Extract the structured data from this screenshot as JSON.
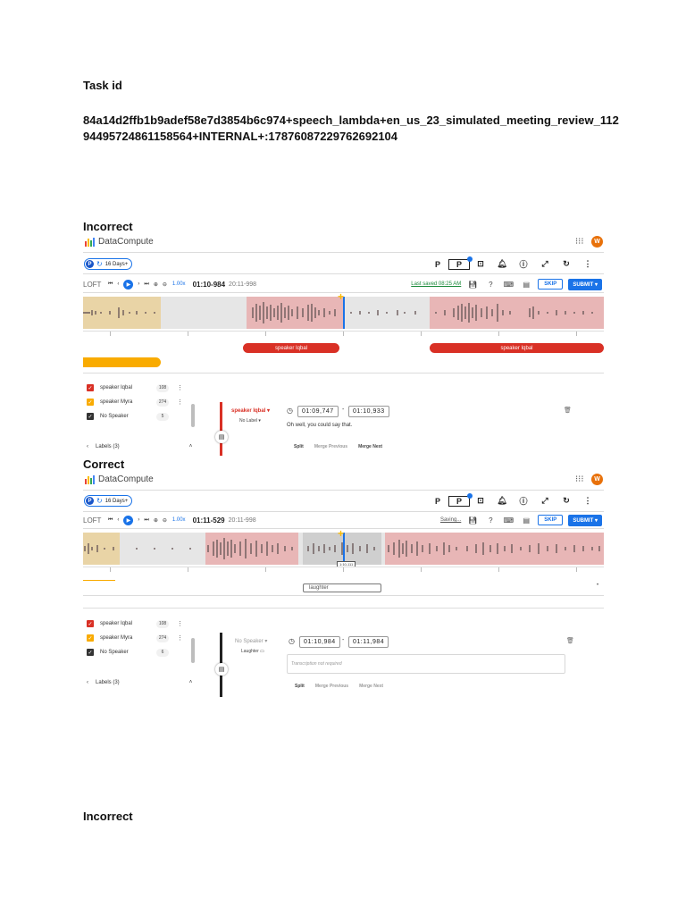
{
  "document": {
    "task_heading": "Task id",
    "task_id": "84a14d2ffb1b9adef58e7d3854b6c974+speech_lambda+en_us_23_simulated_meeting_review_11294495724861158564+INTERNAL+:17876087229762692104",
    "incorrect_label": "Incorrect",
    "correct_label": "Correct",
    "incorrect_label_2": "Incorrect"
  },
  "colors": {
    "accent": "#1a73e8",
    "speaker_red": "#d93025",
    "segment_red_bg": "#e8b6b6",
    "segment_yellow_bg": "#e9d4a6",
    "orange": "#f9ab00",
    "saved_green": "#1a8a3a"
  },
  "app": {
    "brand": "DataCompute",
    "avatar_initial": "W",
    "badge_letter": "P",
    "days_label": "16 Days+",
    "top_icons": [
      "P",
      "P",
      "screenshot-icon",
      "bell-icon",
      "info-icon",
      "expand-icon",
      "refresh-icon",
      "more-vert-icon"
    ],
    "loft_label": "LOFT",
    "speed": "1.00x",
    "skip_label": "SKIP",
    "submit_label": "SUBMIT",
    "split_label": "Split",
    "merge_previous_label": "Merge Previous",
    "merge_next_label": "Merge Next",
    "labels_footer": "Labels (3)"
  },
  "screenshot_incorrect": {
    "timecode": "01:10-984",
    "duration": "20:11-998",
    "save_status": "Last saved 08:25 AM",
    "region_tags": [
      "speaker Iqbal",
      "speaker Iqbal"
    ],
    "labels": [
      {
        "name": "speaker Iqbal",
        "count": "108",
        "color": "#d93025"
      },
      {
        "name": "speaker Myra",
        "count": "274",
        "color": "#f9ab00"
      },
      {
        "name": "No Speaker",
        "count": "5",
        "color": "#333333"
      }
    ],
    "segment": {
      "speaker": "speaker Iqbal",
      "sub_label": "No Label",
      "start": "01:09,747",
      "end": "01:10,933",
      "transcript": "Oh well, you could say that."
    }
  },
  "screenshot_correct": {
    "timecode": "01:11-529",
    "duration": "20:11-998",
    "save_status": "Saving...",
    "hover_time": "1:10-111",
    "region_tag": "laughter",
    "labels": [
      {
        "name": "speaker Iqbal",
        "count": "108",
        "color": "#d93025"
      },
      {
        "name": "speaker Myra",
        "count": "274",
        "color": "#f9ab00"
      },
      {
        "name": "No Speaker",
        "count": "6",
        "color": "#333333"
      }
    ],
    "segment": {
      "speaker": "No Speaker",
      "sub_label": "Laughter",
      "start": "01:10,984",
      "end": "01:11,984",
      "transcript_placeholder": "Transcription not required"
    }
  }
}
